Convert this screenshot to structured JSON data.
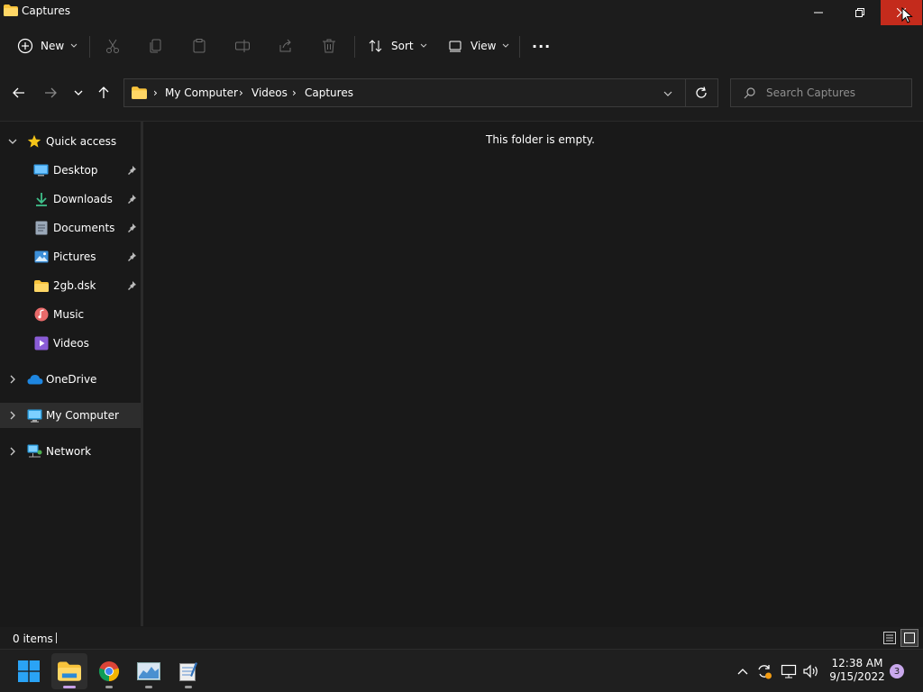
{
  "window": {
    "title": "Captures"
  },
  "toolbar": {
    "new_label": "New",
    "sort_label": "Sort",
    "view_label": "View",
    "more_label": "···"
  },
  "address": {
    "crumbs": [
      "My Computer",
      "Videos",
      "Captures"
    ],
    "search_placeholder": "Search Captures"
  },
  "sidebar": {
    "quick_access": "Quick access",
    "items": [
      {
        "label": "Desktop",
        "pinned": true
      },
      {
        "label": "Downloads",
        "pinned": true
      },
      {
        "label": "Documents",
        "pinned": true
      },
      {
        "label": "Pictures",
        "pinned": true
      },
      {
        "label": "2gb.dsk",
        "pinned": true
      },
      {
        "label": "Music",
        "pinned": false
      },
      {
        "label": "Videos",
        "pinned": false
      }
    ],
    "onedrive": "OneDrive",
    "my_computer": "My Computer",
    "network": "Network"
  },
  "content": {
    "empty_message": "This folder is empty."
  },
  "status": {
    "item_count": "0 items"
  },
  "taskbar": {
    "time": "12:38 AM",
    "date": "9/15/2022",
    "notification_count": "3"
  },
  "colors": {
    "accent": "#0078d4",
    "close_hover": "#c42b1c",
    "folder": "#f8c33c",
    "star": "#f5c518"
  }
}
